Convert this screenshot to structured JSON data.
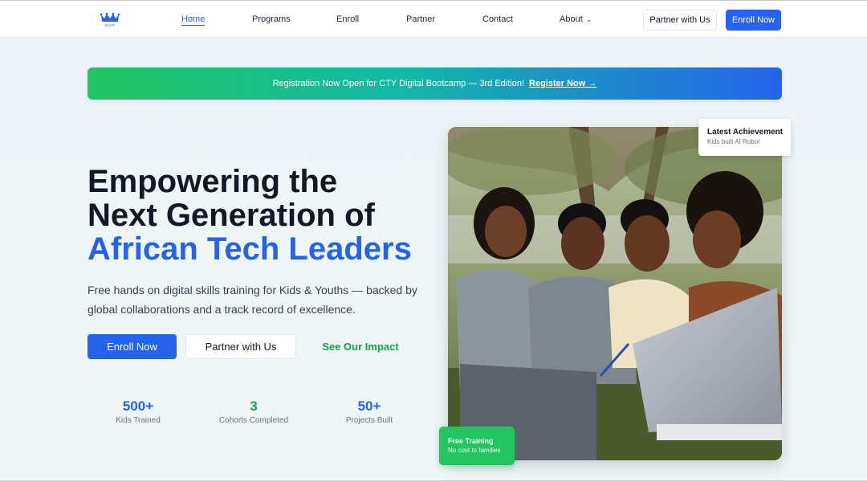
{
  "nav": {
    "logo_icon": "logo-crown-icon",
    "logo_text": "B.O.P",
    "links": [
      "Home",
      "Programs",
      "Enroll",
      "Partner",
      "Contact",
      "About"
    ],
    "active": "Home",
    "partner_button": "Partner with Us",
    "enroll_button": "Enroll Now"
  },
  "banner": {
    "text": "Registration Now Open for CTY Digital Bootcamp — 3rd Edition!",
    "link": "Register Now →"
  },
  "hero": {
    "title_line1": "Empowering the",
    "title_line2": "Next Generation of",
    "title_accent": "African Tech Leaders",
    "subtitle": "Free hands on digital skills training for Kids & Youths — backed by global collaborations and a track record of excellence.",
    "enroll_button": "Enroll Now",
    "partner_button": "Partner with Us",
    "impact_link": "See Our Impact"
  },
  "stats": [
    {
      "value": "500+",
      "label": "Kids Trained",
      "color": "#2563eb"
    },
    {
      "value": "3",
      "label": "Cohorts Completed",
      "color": "#16a34a"
    },
    {
      "value": "50+",
      "label": "Projects Built",
      "color": "#2563eb"
    }
  ],
  "achievement_card": {
    "title": "Latest Achievement",
    "subtitle": "Kids built AI Robot"
  },
  "free_card": {
    "title": "Free Training",
    "subtitle": "No cost to families"
  },
  "colors": {
    "primary": "#2563eb",
    "green": "#22c55e",
    "text": "#111827"
  }
}
